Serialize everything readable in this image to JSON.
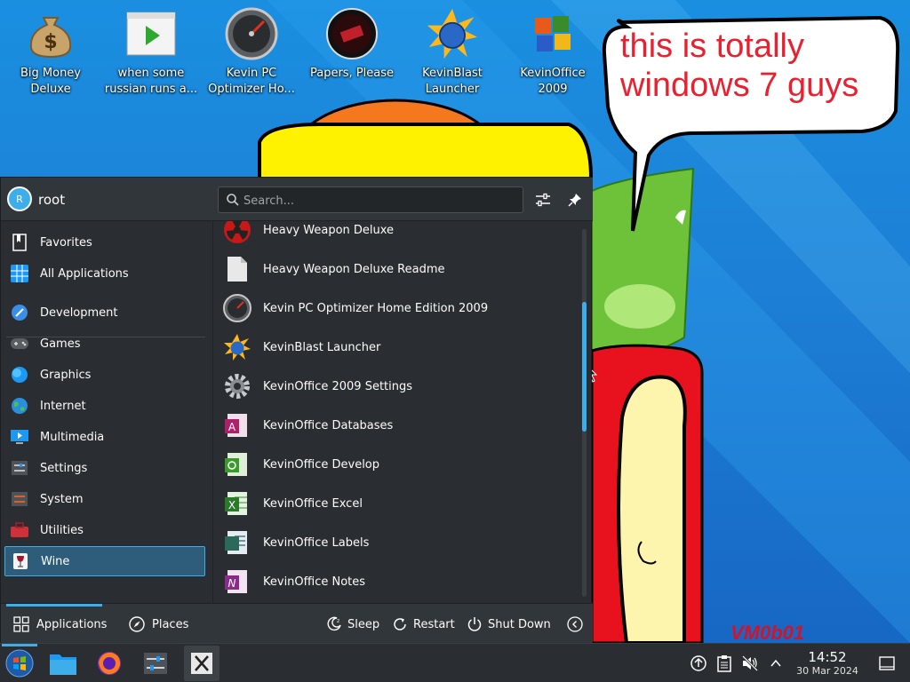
{
  "desktop": {
    "icons": [
      {
        "label_line1": "Big Money",
        "label_line2": "Deluxe",
        "icon": "money-bag-icon"
      },
      {
        "label_line1": "when some",
        "label_line2": "russian runs a...",
        "icon": "video-play-icon"
      },
      {
        "label_line1": "Kevin PC",
        "label_line2": "Optimizer Ho...",
        "icon": "speedometer-icon"
      },
      {
        "label_line1": "Papers, Please",
        "label_line2": "",
        "icon": "papers-please-icon"
      },
      {
        "label_line1": "KevinBlast",
        "label_line2": "Launcher",
        "icon": "kevinblast-icon"
      },
      {
        "label_line1": "KevinOffice",
        "label_line2": "2009",
        "icon": "office-icon"
      }
    ],
    "bubble_line1": "this is totally",
    "bubble_line2": "windows 7 guys",
    "signature": "VM0b01"
  },
  "launcher": {
    "user": {
      "initial": "R",
      "name": "root"
    },
    "search_placeholder": "Search...",
    "sidebar": [
      {
        "label": "Favorites",
        "icon": "bookmarks-icon"
      },
      {
        "label": "All Applications",
        "icon": "grid-icon"
      },
      {
        "label": "Development",
        "icon": "development-icon"
      },
      {
        "label": "Games",
        "icon": "gamepad-icon"
      },
      {
        "label": "Graphics",
        "icon": "graphics-icon"
      },
      {
        "label": "Internet",
        "icon": "globe-icon"
      },
      {
        "label": "Multimedia",
        "icon": "multimedia-icon"
      },
      {
        "label": "Settings",
        "icon": "settings-icon"
      },
      {
        "label": "System",
        "icon": "system-icon"
      },
      {
        "label": "Utilities",
        "icon": "toolbox-icon"
      },
      {
        "label": "Wine",
        "icon": "wine-icon"
      }
    ],
    "selected_category": "Wine",
    "apps": [
      {
        "label": "Heavy Weapon Deluxe",
        "icon": "radiation-icon"
      },
      {
        "label": "Heavy Weapon Deluxe Readme",
        "icon": "document-icon"
      },
      {
        "label": "Kevin PC Optimizer Home Edition 2009",
        "icon": "speedometer-icon"
      },
      {
        "label": "KevinBlast Launcher",
        "icon": "kevinblast-icon"
      },
      {
        "label": "KevinOffice 2009 Settings",
        "icon": "gear-icon"
      },
      {
        "label": "KevinOffice Databases",
        "icon": "office-databases-icon"
      },
      {
        "label": "KevinOffice Develop",
        "icon": "office-develop-icon"
      },
      {
        "label": "KevinOffice Excel",
        "icon": "office-excel-icon"
      },
      {
        "label": "KevinOffice Labels",
        "icon": "office-labels-icon"
      },
      {
        "label": "KevinOffice Notes",
        "icon": "office-notes-icon"
      }
    ],
    "tabs": {
      "applications": "Applications",
      "places": "Places"
    },
    "power": {
      "sleep": "Sleep",
      "restart": "Restart",
      "shutdown": "Shut Down"
    }
  },
  "taskbar": {
    "clock_time": "14:52",
    "clock_date": "30 Mar 2024"
  },
  "colors": {
    "accent": "#3daee9",
    "panel": "#2a2e32",
    "bubble_text": "#e8202f"
  }
}
